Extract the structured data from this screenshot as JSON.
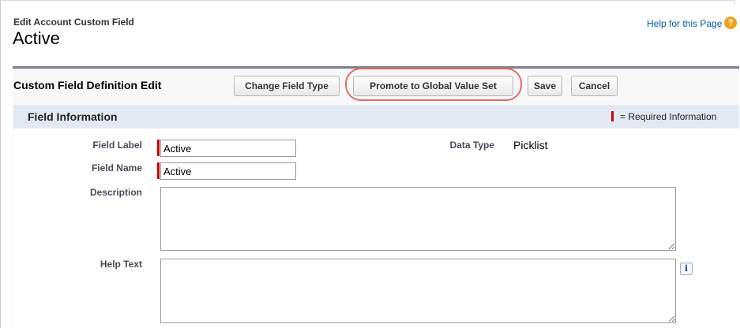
{
  "header": {
    "subtitle": "Edit Account Custom Field",
    "title": "Active",
    "help_link": "Help for this Page",
    "help_icon_glyph": "?"
  },
  "toolbar": {
    "title": "Custom Field Definition Edit",
    "change_field_type": "Change Field Type",
    "promote": "Promote to Global Value Set",
    "save": "Save",
    "cancel": "Cancel"
  },
  "section": {
    "title": "Field Information",
    "required_info": "= Required Information"
  },
  "fields": {
    "field_label": {
      "label": "Field Label",
      "value": "Active"
    },
    "field_name": {
      "label": "Field Name",
      "value": "Active"
    },
    "description": {
      "label": "Description",
      "value": ""
    },
    "help_text": {
      "label": "Help Text",
      "value": "",
      "info_glyph": "i"
    },
    "data_type": {
      "label": "Data Type",
      "value": "Picklist"
    }
  },
  "colors": {
    "required": "#cc0000",
    "section_bar": "#e3e9f3",
    "link": "#015ba7",
    "highlight": "#e56a6a"
  }
}
